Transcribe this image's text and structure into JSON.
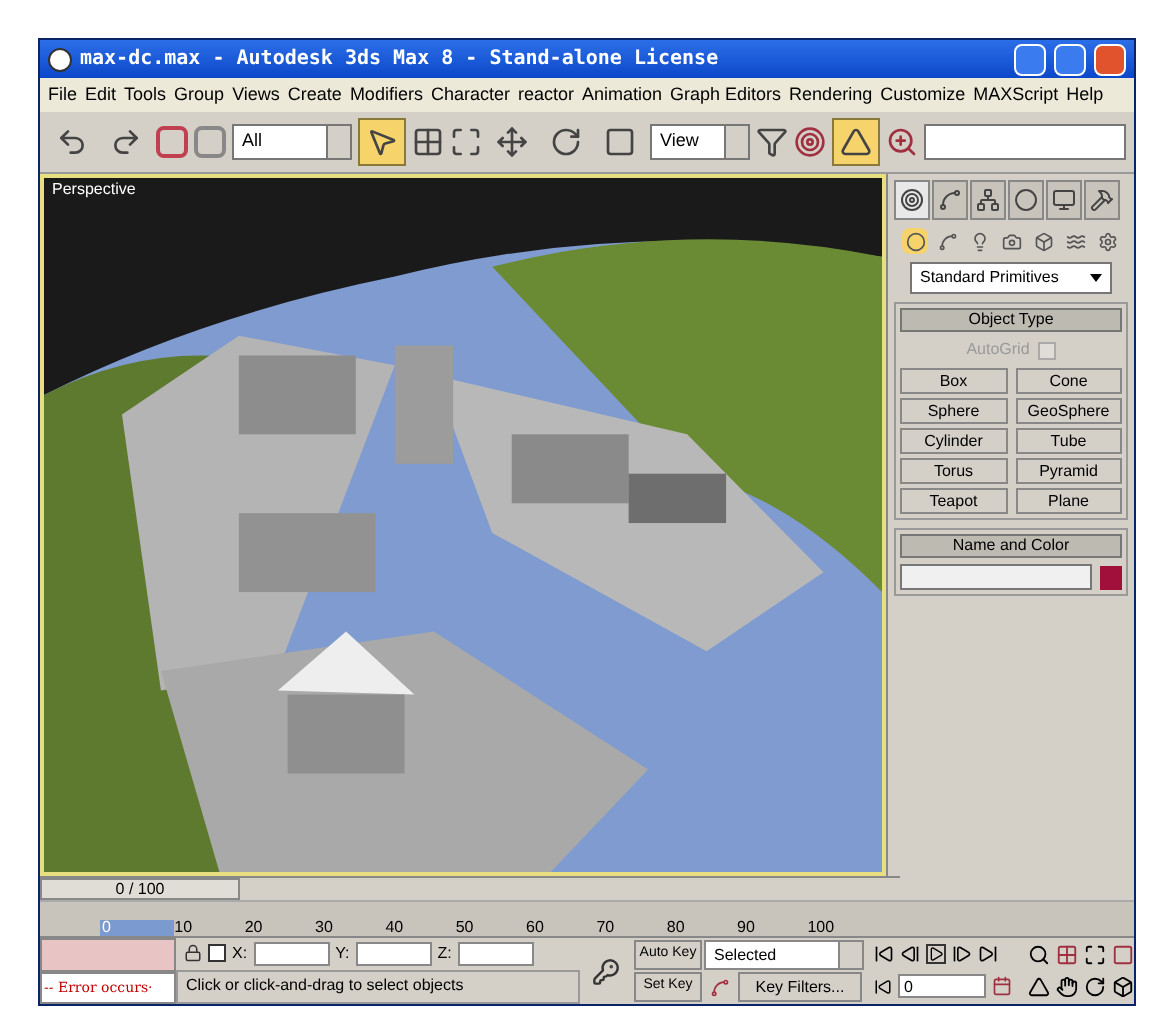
{
  "window": {
    "title": "max-dc.max - Autodesk 3ds Max 8  - Stand-alone License"
  },
  "menu": [
    "File",
    "Edit",
    "Tools",
    "Group",
    "Views",
    "Create",
    "Modifiers",
    "Character",
    "reactor",
    "Animation",
    "Graph Editors",
    "Rendering",
    "Customize",
    "MAXScript",
    "Help"
  ],
  "toolbar": {
    "selection_filter": "All",
    "reference_coord": "View",
    "tools": [
      {
        "kind": "undo",
        "selected": false
      },
      {
        "kind": "redo",
        "selected": false
      },
      {
        "kind": "select",
        "selected": true
      },
      {
        "kind": "move",
        "selected": false
      },
      {
        "kind": "rotate",
        "selected": false
      },
      {
        "kind": "scale",
        "selected": false
      },
      {
        "kind": "angle-snap",
        "selected": true
      }
    ]
  },
  "viewport": {
    "label": "Perspective"
  },
  "command_panel": {
    "tabs": [
      {
        "kind": "create",
        "selected": true
      },
      {
        "kind": "modify",
        "selected": false
      },
      {
        "kind": "hierarchy",
        "selected": false
      },
      {
        "kind": "motion",
        "selected": false
      },
      {
        "kind": "display",
        "selected": false
      },
      {
        "kind": "utilities",
        "selected": false
      }
    ],
    "categories": [
      {
        "kind": "geometry",
        "selected": true
      },
      {
        "kind": "shapes",
        "selected": false
      },
      {
        "kind": "lights",
        "selected": false
      },
      {
        "kind": "cameras",
        "selected": false
      },
      {
        "kind": "helpers",
        "selected": false
      },
      {
        "kind": "spacewarps",
        "selected": false
      },
      {
        "kind": "systems",
        "selected": false
      }
    ],
    "dropdown": "Standard Primitives",
    "object_type": {
      "title": "Object Type",
      "autogrid": {
        "label": "AutoGrid",
        "checked": false,
        "disabled": true
      },
      "buttons": [
        "Box",
        "Cone",
        "Sphere",
        "GeoSphere",
        "Cylinder",
        "Tube",
        "Torus",
        "Pyramid",
        "Teapot",
        "Plane"
      ]
    },
    "name_and_color": {
      "title": "Name and Color",
      "color": "#a0103a"
    }
  },
  "time_slider": {
    "label": "0 / 100",
    "level": 0,
    "ticks": [
      "0",
      "10",
      "20",
      "30",
      "40",
      "50",
      "60",
      "70",
      "80",
      "90",
      "100"
    ]
  },
  "status": {
    "error": "-- Error occurs·",
    "prompt": "Click or click-and-drag to select objects",
    "coords": [
      "X:",
      "Y:",
      "Z:"
    ]
  },
  "animation": {
    "auto_key": "Auto Key",
    "set_key": "Set Key",
    "key_mode": "Selected",
    "key_filters": "Key Filters...",
    "frame": "0"
  }
}
